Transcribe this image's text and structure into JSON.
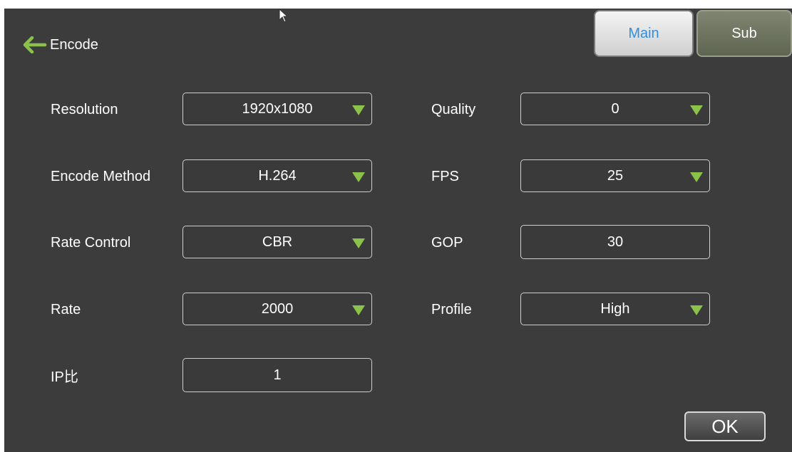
{
  "header": {
    "title": "Encode",
    "back_icon": "arrow-left-icon",
    "back_color": "#8bc34a"
  },
  "tabs": {
    "main_label": "Main",
    "sub_label": "Sub",
    "active": "Main",
    "active_color": "#2f8fe0"
  },
  "left": {
    "resolution": {
      "label": "Resolution",
      "value": "1920x1080"
    },
    "encode_method": {
      "label": "Encode Method",
      "value": "H.264"
    },
    "rate_control": {
      "label": "Rate Control",
      "value": "CBR"
    },
    "rate": {
      "label": "Rate",
      "value": "2000"
    },
    "ip_ratio": {
      "label": "IP比",
      "value": "1"
    }
  },
  "right": {
    "quality": {
      "label": "Quality",
      "value": "0"
    },
    "fps": {
      "label": "FPS",
      "value": "25"
    },
    "gop": {
      "label": "GOP",
      "value": "30"
    },
    "profile": {
      "label": "Profile",
      "value": "High"
    }
  },
  "footer": {
    "ok_label": "OK"
  },
  "accent_color": "#8bc34a"
}
